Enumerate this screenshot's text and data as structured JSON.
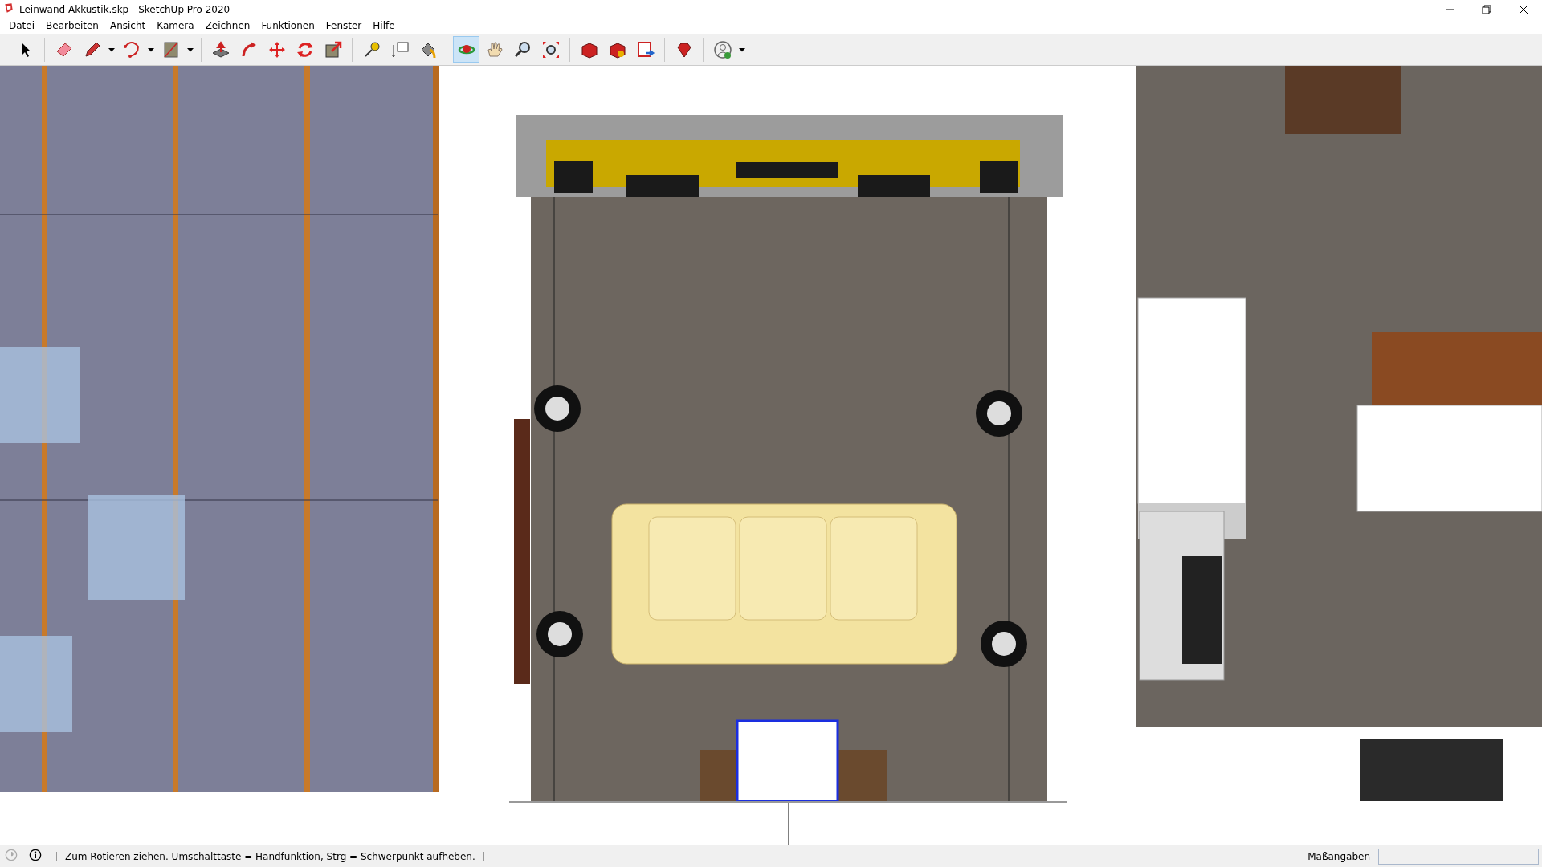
{
  "window": {
    "title": "Leinwand Akkustik.skp - SketchUp Pro 2020"
  },
  "menu": [
    "Datei",
    "Bearbeiten",
    "Ansicht",
    "Kamera",
    "Zeichnen",
    "Funktionen",
    "Fenster",
    "Hilfe"
  ],
  "toolbar": {
    "groups": [
      {
        "tools": [
          {
            "kind": "select",
            "selected": false
          }
        ]
      },
      {
        "tools": [
          {
            "kind": "eraser",
            "selected": false
          },
          {
            "kind": "pencil",
            "selected": false
          },
          {
            "kind": "dropdown"
          },
          {
            "kind": "arc",
            "selected": false
          },
          {
            "kind": "dropdown"
          },
          {
            "kind": "rectangle",
            "selected": false
          },
          {
            "kind": "dropdown"
          }
        ]
      },
      {
        "tools": [
          {
            "kind": "pushpull",
            "selected": false
          },
          {
            "kind": "followme",
            "selected": false
          },
          {
            "kind": "move",
            "selected": false
          },
          {
            "kind": "rotate",
            "selected": false
          },
          {
            "kind": "scale",
            "selected": false
          }
        ]
      },
      {
        "tools": [
          {
            "kind": "tape",
            "selected": false
          },
          {
            "kind": "text",
            "selected": false
          },
          {
            "kind": "paint",
            "selected": false
          }
        ]
      },
      {
        "tools": [
          {
            "kind": "orbit",
            "selected": true
          },
          {
            "kind": "pan",
            "selected": false
          },
          {
            "kind": "zoom",
            "selected": false
          },
          {
            "kind": "zoomextents",
            "selected": false
          }
        ]
      },
      {
        "tools": [
          {
            "kind": "warehouse",
            "selected": false
          },
          {
            "kind": "extensions",
            "selected": false
          },
          {
            "kind": "layout",
            "selected": false
          }
        ]
      },
      {
        "tools": [
          {
            "kind": "ruby",
            "selected": false
          }
        ]
      },
      {
        "tools": [
          {
            "kind": "account",
            "selected": false
          },
          {
            "kind": "dropdown"
          }
        ]
      }
    ]
  },
  "status_bar": {
    "message": "Zum Rotieren ziehen. Umschalttaste = Handfunktion, Strg = Schwerpunkt aufheben.",
    "measurements_label": "Maßangaben"
  }
}
